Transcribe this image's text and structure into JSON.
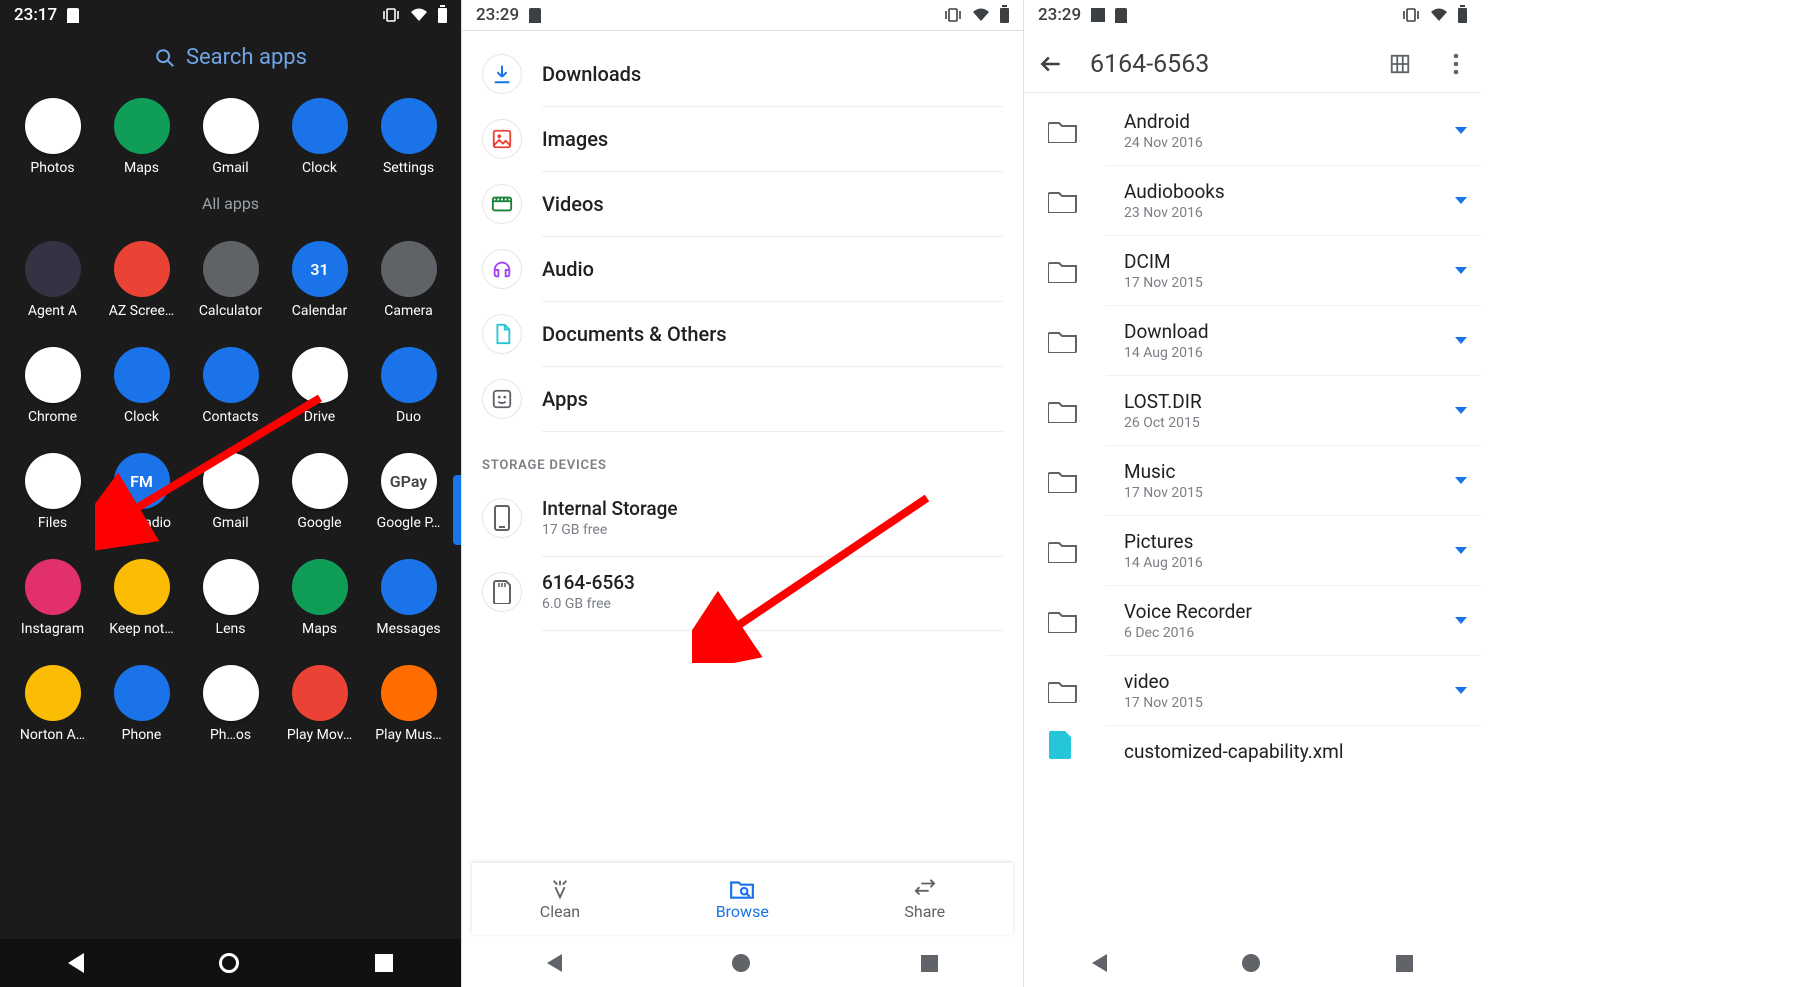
{
  "panel1": {
    "time": "23:17",
    "search_label": "Search apps",
    "allapps_label": "All apps",
    "apps_favorites": [
      {
        "label": "Photos",
        "color": "#ffffff"
      },
      {
        "label": "Maps",
        "color": "#0f9d58"
      },
      {
        "label": "Gmail",
        "color": "#ffffff"
      },
      {
        "label": "Clock",
        "color": "#1a73e8"
      },
      {
        "label": "Settings",
        "color": "#1a73e8"
      }
    ],
    "apps_all": [
      {
        "label": "Agent A",
        "color": "#334"
      },
      {
        "label": "AZ Scree…",
        "color": "#ea4335"
      },
      {
        "label": "Calculator",
        "color": "#5f6368"
      },
      {
        "label": "Calendar",
        "color": "#1a73e8",
        "badge": "31"
      },
      {
        "label": "Camera",
        "color": "#5f6368"
      },
      {
        "label": "Chrome",
        "color": "#ffffff"
      },
      {
        "label": "Clock",
        "color": "#1a73e8"
      },
      {
        "label": "Contacts",
        "color": "#1a73e8"
      },
      {
        "label": "Drive",
        "color": "#ffffff"
      },
      {
        "label": "Duo",
        "color": "#1a73e8"
      },
      {
        "label": "Files",
        "color": "#ffffff"
      },
      {
        "label": "FM Radio",
        "color": "#1a73e8",
        "badge": "FM"
      },
      {
        "label": "Gmail",
        "color": "#ffffff"
      },
      {
        "label": "Google",
        "color": "#ffffff"
      },
      {
        "label": "Google P…",
        "color": "#ffffff",
        "badge": "GPay"
      },
      {
        "label": "Instagram",
        "color": "#e1306c"
      },
      {
        "label": "Keep not…",
        "color": "#fbbc04"
      },
      {
        "label": "Lens",
        "color": "#ffffff"
      },
      {
        "label": "Maps",
        "color": "#0f9d58"
      },
      {
        "label": "Messages",
        "color": "#1a73e8"
      },
      {
        "label": "Norton A…",
        "color": "#fbbc04"
      },
      {
        "label": "Phone",
        "color": "#1a73e8"
      },
      {
        "label": "Ph…os",
        "color": "#ffffff"
      },
      {
        "label": "Play Mov…",
        "color": "#ea4335"
      },
      {
        "label": "Play Mus…",
        "color": "#ff6d00"
      }
    ]
  },
  "panel2": {
    "time": "23:29",
    "categories": [
      {
        "label": "Downloads",
        "color": "#1a73e8"
      },
      {
        "label": "Images",
        "color": "#ea4335"
      },
      {
        "label": "Videos",
        "color": "#188038"
      },
      {
        "label": "Audio",
        "color": "#a142f4"
      },
      {
        "label": "Documents & Others",
        "color": "#26c6da"
      },
      {
        "label": "Apps",
        "color": "#5f6368"
      }
    ],
    "storage_header": "STORAGE DEVICES",
    "storage": [
      {
        "name": "Internal Storage",
        "sub": "17 GB free",
        "icon": "phone"
      },
      {
        "name": "6164-6563",
        "sub": "6.0 GB free",
        "icon": "sd"
      }
    ],
    "bottom": {
      "clean": "Clean",
      "browse": "Browse",
      "share": "Share"
    }
  },
  "panel3": {
    "time": "23:29",
    "title": "6164-6563",
    "folders": [
      {
        "name": "Android",
        "date": "24 Nov 2016"
      },
      {
        "name": "Audiobooks",
        "date": "23 Nov 2016"
      },
      {
        "name": "DCIM",
        "date": "17 Nov 2015"
      },
      {
        "name": "Download",
        "date": "14 Aug 2016"
      },
      {
        "name": "LOST.DIR",
        "date": "26 Oct 2015"
      },
      {
        "name": "Music",
        "date": "17 Nov 2015"
      },
      {
        "name": "Pictures",
        "date": "14 Aug 2016"
      },
      {
        "name": "Voice Recorder",
        "date": "6 Dec 2016"
      },
      {
        "name": "video",
        "date": "17 Nov 2015"
      }
    ],
    "trailing_file": "customized-capability.xml"
  }
}
